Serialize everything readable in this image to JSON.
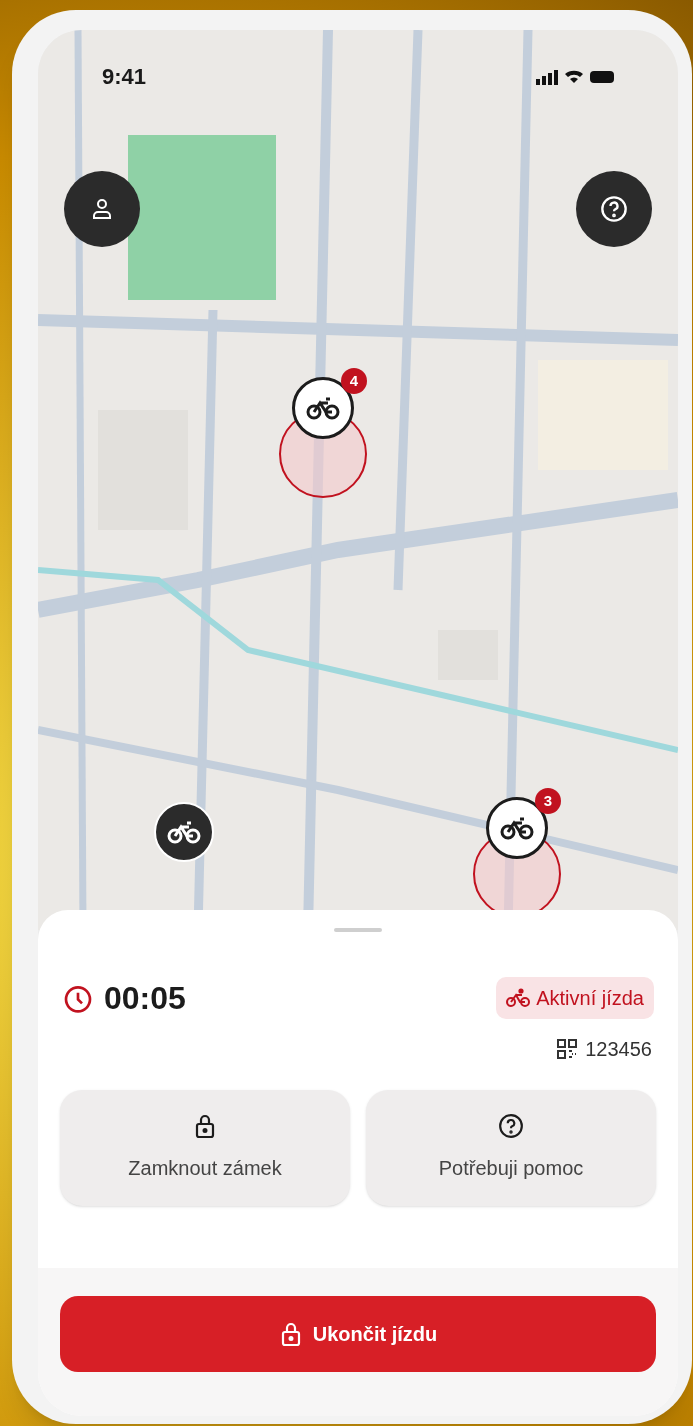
{
  "status_bar": {
    "time": "9:41"
  },
  "map": {
    "markers": [
      {
        "kind": "cluster",
        "count": "4",
        "zone": true
      },
      {
        "kind": "cluster",
        "count": "3",
        "zone": true
      },
      {
        "kind": "single",
        "zone": false
      }
    ]
  },
  "ride": {
    "timer": "00:05",
    "status": "Aktivní jízda",
    "bike_code": "123456"
  },
  "actions": [
    {
      "label": "Zamknout zámek",
      "kind": "lock"
    },
    {
      "label": "Potřebuji pomoc",
      "kind": "help"
    }
  ],
  "end_button": {
    "label": "Ukončit jízdu"
  }
}
